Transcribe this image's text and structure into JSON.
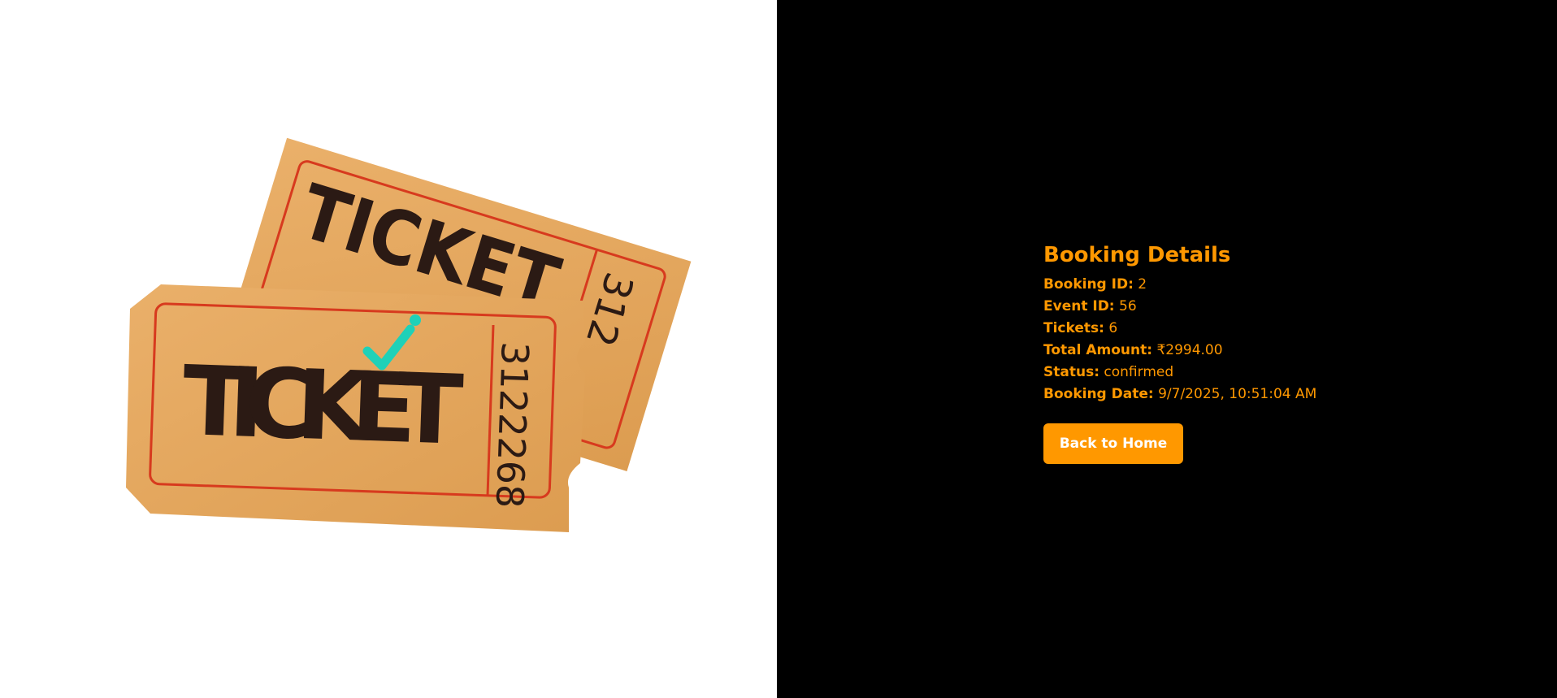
{
  "ticket_graphic": {
    "word": "TICKET",
    "number": "3122268",
    "back_number_fragment": "312"
  },
  "details": {
    "title": "Booking Details",
    "rows": [
      {
        "label": "Booking ID:",
        "value": "2"
      },
      {
        "label": "Event ID:",
        "value": "56"
      },
      {
        "label": "Tickets:",
        "value": "6"
      },
      {
        "label": "Total Amount:",
        "value": "₹2994.00"
      },
      {
        "label": "Status:",
        "value": "confirmed"
      },
      {
        "label": "Booking Date:",
        "value": "9/7/2025, 10:51:04 AM"
      }
    ],
    "back_button_label": "Back to Home"
  },
  "colors": {
    "accent": "#ff9800",
    "ticket_paper": "#e8a85a",
    "ticket_border": "#d73a1e",
    "ticket_ink": "#2b1a14",
    "check": "#1fd1b8"
  }
}
